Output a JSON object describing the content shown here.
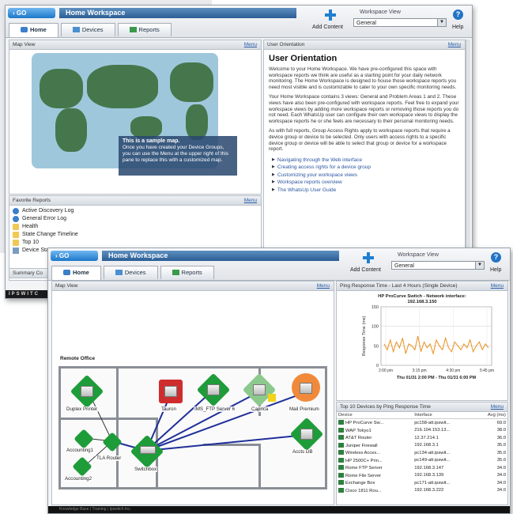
{
  "back": {
    "go_label": "GO",
    "title": "Home Workspace",
    "tabs": [
      "Home",
      "Devices",
      "Reports"
    ],
    "add_content": "Add Content",
    "workspace_view_label": "Workspace View",
    "workspace_view_value": "General",
    "help": "Help",
    "map_view": {
      "title": "Map View",
      "menu": "Menu",
      "note_title": "This is a sample map.",
      "note_text": "Once you have created your Device Groups, you can use the Menu at the upper right of this pane to replace this with a customized map."
    },
    "favorite_reports": {
      "title": "Favorite Reports",
      "menu": "Menu",
      "items": [
        "Active Discovery Log",
        "General Error Log",
        "Health",
        "State Change Timeline",
        "Top 10",
        "Device Sta"
      ]
    },
    "summary": "Summary Co",
    "footer_brand": "IPSWITC",
    "user_orientation": {
      "header": "User Orientation",
      "menu": "Menu",
      "heading": "User Orientation",
      "paragraphs": [
        "Welcome to your Home Workspace. We have pre-configured this space with workspace reports we think are useful as a starting point for your daily network monitoring. The Home Workspace is designed to house those workspace reports you need most visible and is customizable to cater to your own specific monitoring needs.",
        "Your Home Workspace contains 3 views: General and Problem Areas 1 and 2. These views have also been pre-configured with workspace reports. Feel free to expand your workspace views by adding more workspace reports or removing those reports you do not need. Each WhatsUp user can configure their own workspace views to display the workspace reports he or she feels are necessary to their personal monitoring needs.",
        "As with full reports, Group Access Rights apply to workspace reports that require a device group or device to be selected. Only users with access rights to a specific device group or device will be able to select that group or device for a workspace report."
      ],
      "links": [
        "Navigating through the Web interface",
        "Creating access rights for a device group",
        "Customizing your workspace views",
        "Workspace reports overview",
        "The WhatsUp User Guide"
      ]
    }
  },
  "front": {
    "go_label": "GO",
    "title": "Home Workspace",
    "tabs": [
      "Home",
      "Devices",
      "Reports"
    ],
    "add_content": "Add Content",
    "workspace_view_label": "Workspace View",
    "workspace_view_value": "General",
    "help": "Help",
    "map_view": {
      "title": "Map View",
      "menu": "Menu",
      "office_label": "Remote Office",
      "devices": [
        "Duplex Printer",
        "Tauron",
        "IMS_FTP Server 6",
        "Caprica",
        "Mail Premium",
        "Accounting1",
        "TLA Router",
        "Switchbox",
        "Accounting2",
        "Accts DB"
      ]
    },
    "ping": {
      "header": "Ping Response Time - Last 4 Hours (Single Device)",
      "menu": "Menu",
      "chart_title_1": "HP ProCurve Switch - Network interface:",
      "chart_title_2": "192.168.3.150",
      "ylabel": "Response Time (ms)",
      "yticks": [
        "150",
        "100",
        "50",
        "0"
      ],
      "xticks": [
        "2:00 pm",
        "3:15 pm",
        "4:30 pm",
        "5:45 pm"
      ],
      "range": "Thu 01/31 2:00 PM - Thu 01/31 6:00 PM"
    },
    "top10": {
      "header": "Top 10 Devices by Ping Response Time",
      "menu": "Menu",
      "columns": [
        "Device",
        "Interface",
        "Avg (ms)"
      ],
      "rows": [
        [
          "HP ProCurve Sw...",
          "pc158-att.ipswit...",
          "69.0"
        ],
        [
          "WAP Tokyo1",
          "216.104.153.13...",
          "38.0"
        ],
        [
          "AT&T Router",
          "12.37.214.1",
          "36.0"
        ],
        [
          "Juniper Firewall",
          "192.168.3.1",
          "35.0"
        ],
        [
          "Wireless Acces...",
          "pc134-att.ipswit...",
          "35.0"
        ],
        [
          "HP 2500C+ Prin...",
          "pc149-att.ipswit...",
          "35.0"
        ],
        [
          "Rome FTP Server",
          "192.168.3.147",
          "34.0"
        ],
        [
          "Rome File Server",
          "192.168.3.139",
          "34.0"
        ],
        [
          "Exchange Box",
          "pc171-att.ipswit...",
          "34.0"
        ],
        [
          "Cisco 1811 Rou...",
          "192.168.3.222",
          "34.0"
        ]
      ]
    },
    "footer": "Knowledge Base | Training | Ipswitch Inc."
  },
  "chart_data": {
    "type": "line",
    "title": "HP ProCurve Switch - Network interface: 192.168.3.150",
    "ylabel": "Response Time (ms)",
    "xlabel": "Thu 01/31 2:00 PM - Thu 01/31 6:00 PM",
    "ylim": [
      0,
      150
    ],
    "xticks": [
      "2:00 pm",
      "3:15 pm",
      "4:30 pm",
      "5:45 pm"
    ],
    "values": [
      55,
      40,
      65,
      35,
      60,
      45,
      70,
      30,
      55,
      50,
      40,
      75,
      35,
      60,
      45,
      55,
      30,
      65,
      50,
      40,
      70,
      45,
      35,
      60,
      50,
      40,
      55,
      45,
      65,
      35,
      50,
      60,
      40,
      55,
      45
    ],
    "color": "#e8901c",
    "grid": true
  }
}
